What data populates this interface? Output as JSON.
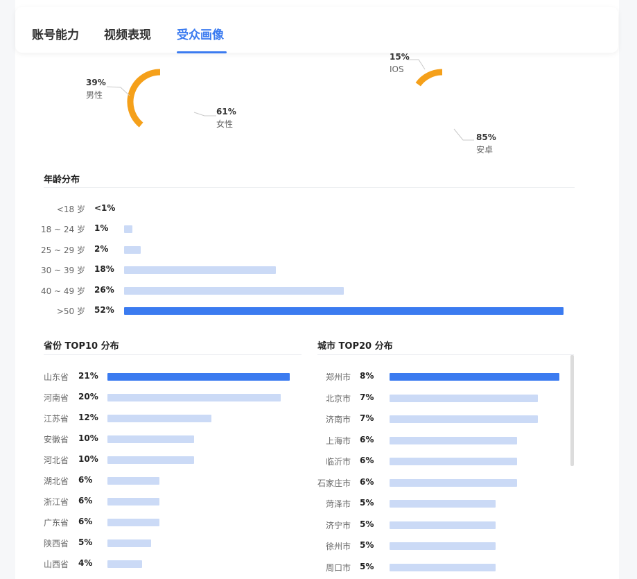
{
  "tabs": [
    {
      "label": "账号能力",
      "active": false
    },
    {
      "label": "视频表现",
      "active": false
    },
    {
      "label": "受众画像",
      "active": true
    }
  ],
  "gender": {
    "male": {
      "pct": "39%",
      "name": "男性",
      "value": 39,
      "color": "#f5a01a"
    },
    "female": {
      "pct": "61%",
      "name": "女性",
      "value": 61,
      "color": "#3b7bf0"
    }
  },
  "device": {
    "ios": {
      "pct": "15%",
      "name": "IOS",
      "value": 15,
      "color": "#f5a01a"
    },
    "android": {
      "pct": "85%",
      "name": "安卓",
      "value": 85,
      "color": "#3b7bf0"
    }
  },
  "age": {
    "title": "年龄分布",
    "rows": [
      {
        "label": "<18 岁",
        "pct": "<1%",
        "value": 0
      },
      {
        "label": "18 ~ 24 岁",
        "pct": "1%",
        "value": 1
      },
      {
        "label": "25 ~ 29 岁",
        "pct": "2%",
        "value": 2
      },
      {
        "label": "30 ~ 39 岁",
        "pct": "18%",
        "value": 18
      },
      {
        "label": "40 ~ 49 岁",
        "pct": "26%",
        "value": 26
      },
      {
        "label": ">50 岁",
        "pct": "52%",
        "value": 52
      }
    ]
  },
  "province": {
    "title": "省份 TOP10 分布",
    "rows": [
      {
        "label": "山东省",
        "pct": "21%",
        "value": 21
      },
      {
        "label": "河南省",
        "pct": "20%",
        "value": 20
      },
      {
        "label": "江苏省",
        "pct": "12%",
        "value": 12
      },
      {
        "label": "安徽省",
        "pct": "10%",
        "value": 10
      },
      {
        "label": "河北省",
        "pct": "10%",
        "value": 10
      },
      {
        "label": "湖北省",
        "pct": "6%",
        "value": 6
      },
      {
        "label": "浙江省",
        "pct": "6%",
        "value": 6
      },
      {
        "label": "广东省",
        "pct": "6%",
        "value": 6
      },
      {
        "label": "陕西省",
        "pct": "5%",
        "value": 5
      },
      {
        "label": "山西省",
        "pct": "4%",
        "value": 4
      }
    ]
  },
  "city": {
    "title": "城市 TOP20 分布",
    "rows": [
      {
        "label": "郑州市",
        "pct": "8%",
        "value": 8
      },
      {
        "label": "北京市",
        "pct": "7%",
        "value": 7
      },
      {
        "label": "济南市",
        "pct": "7%",
        "value": 7
      },
      {
        "label": "上海市",
        "pct": "6%",
        "value": 6
      },
      {
        "label": "临沂市",
        "pct": "6%",
        "value": 6
      },
      {
        "label": "石家庄市",
        "pct": "6%",
        "value": 6
      },
      {
        "label": "菏泽市",
        "pct": "5%",
        "value": 5
      },
      {
        "label": "济宁市",
        "pct": "5%",
        "value": 5
      },
      {
        "label": "徐州市",
        "pct": "5%",
        "value": 5
      },
      {
        "label": "周口市",
        "pct": "5%",
        "value": 5
      }
    ]
  }
}
